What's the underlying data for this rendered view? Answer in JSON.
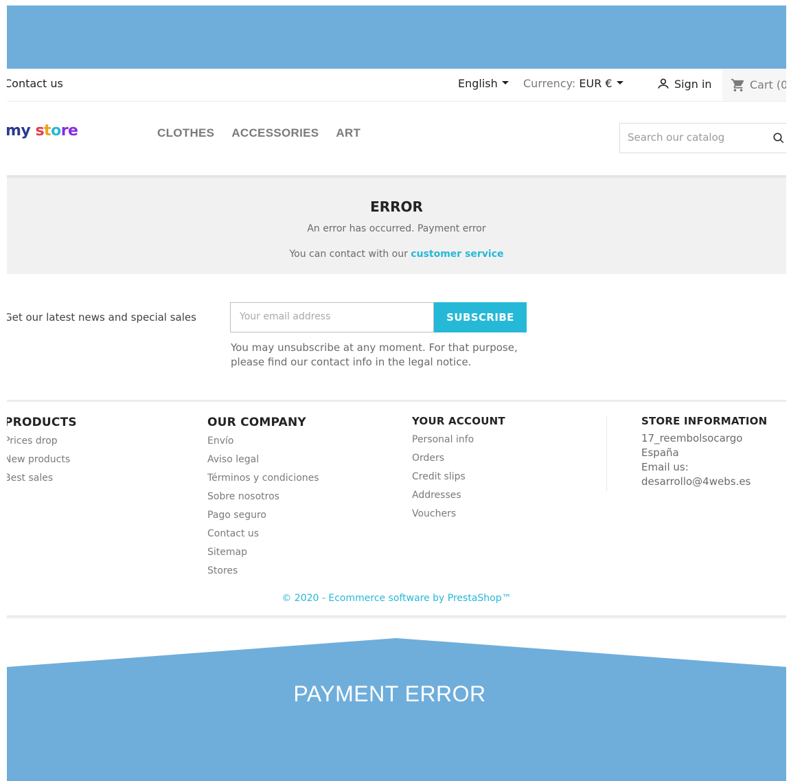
{
  "header": {
    "contact_link": "Contact us",
    "language": "English",
    "currency_label": "Currency:",
    "currency_value": "EUR €",
    "sign_in": "Sign in",
    "cart": "Cart (0"
  },
  "logo": {
    "part1": "my ",
    "part2": "s",
    "part3": "t",
    "part4": "o",
    "part5": "re"
  },
  "menu": [
    "CLOTHES",
    "ACCESSORIES",
    "ART"
  ],
  "search": {
    "placeholder": "Search our catalog",
    "icon": "search-icon"
  },
  "error": {
    "title": "ERROR",
    "message": "An error has occurred. Payment error",
    "contact_prefix": "You can contact with our ",
    "contact_link": "customer service"
  },
  "newsletter": {
    "text": "Get our latest news and special sales",
    "placeholder": "Your email address",
    "button": "SUBSCRIBE",
    "note": "You may unsubscribe at any moment. For that purpose, please find our contact info in the legal notice."
  },
  "footer": {
    "products": {
      "title": "PRODUCTS",
      "items": [
        "Prices drop",
        "New products",
        "Best sales"
      ]
    },
    "company": {
      "title": "OUR COMPANY",
      "items": [
        "Envío",
        "Aviso legal",
        "Términos y condiciones",
        "Sobre nosotros",
        "Pago seguro",
        "Contact us",
        "Sitemap",
        "Stores"
      ]
    },
    "account": {
      "title": "YOUR ACCOUNT",
      "items": [
        "Personal info",
        "Orders",
        "Credit slips",
        "Addresses",
        "Vouchers"
      ]
    },
    "store": {
      "title": "STORE INFORMATION",
      "lines": [
        "17_reembolsocargo",
        "España",
        "Email us:",
        "desarrollo@4webs.es"
      ]
    },
    "copyright": "© 2020 - Ecommerce software by PrestaShop™"
  },
  "banner": {
    "title": "PAYMENT ERROR"
  },
  "colors": {
    "banner_blue": "#6faedb",
    "accent": "#25b9d7",
    "panel_gray": "#f1f1f1"
  }
}
